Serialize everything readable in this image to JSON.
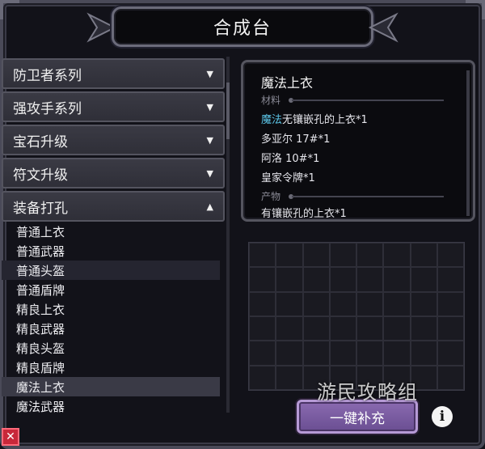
{
  "window": {
    "title": "合成台"
  },
  "categories": [
    {
      "label": "防卫者系列",
      "arrow": "▼"
    },
    {
      "label": "强攻手系列",
      "arrow": "▼"
    },
    {
      "label": "宝石升级",
      "arrow": "▼"
    },
    {
      "label": "符文升级",
      "arrow": "▼"
    },
    {
      "label": "装备打孔",
      "arrow": "▲"
    }
  ],
  "sub_items": [
    "普通上衣",
    "普通武器",
    "普通头盔",
    "普通盾牌",
    "精良上衣",
    "精良武器",
    "精良头盔",
    "精良盾牌",
    "魔法上衣",
    "魔法武器"
  ],
  "selected_item": "魔法上衣",
  "recipe": {
    "name": "魔法上衣",
    "materials_label": "材料",
    "materials": [
      {
        "highlight": "魔法",
        "text": "无镶嵌孔的上衣*1"
      },
      {
        "highlight": "",
        "text": "多亚尔 17#*1"
      },
      {
        "highlight": "",
        "text": "阿洛 10#*1"
      },
      {
        "highlight": "",
        "text": "皇家令牌*1"
      }
    ],
    "product_label": "产物",
    "product": "有镶嵌孔的上衣*1"
  },
  "buttons": {
    "fill": "一键补充",
    "info": "i",
    "close": "✕"
  },
  "watermark": "游民攻略组",
  "colors": {
    "highlight": "#5cc6e8",
    "button": "#7a5ca6",
    "close": "#c8283a"
  },
  "icons": {
    "info": "info-icon",
    "close": "close-icon"
  }
}
